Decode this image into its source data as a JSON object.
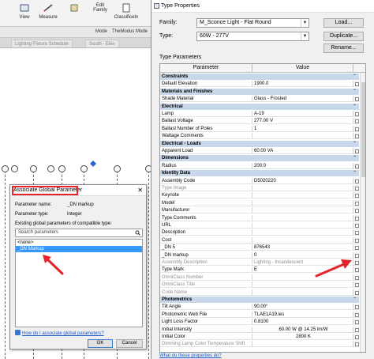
{
  "ribbon": {
    "items": [
      {
        "label": "View"
      },
      {
        "label": "Measure"
      },
      {
        "label": "Edit Family"
      },
      {
        "label": "ClassificeIn"
      },
      {
        "label": "Mode"
      },
      {
        "label": "TheModus Mode"
      }
    ]
  },
  "tabs": [
    {
      "label": "Lighting Fixture Schedule"
    },
    {
      "label": "South - Elev"
    }
  ],
  "associate_dialog": {
    "title": "Associate Global Parameter",
    "parameter_name_label": "Parameter name:",
    "parameter_name_value": "_DN markup",
    "parameter_type_label": "Parameter type:",
    "parameter_type_value": "Integer",
    "existing_label": "Existing global parameters of compatible type:",
    "search_placeholder": "Search parameters",
    "list": [
      {
        "label": "<none>",
        "selected": false
      },
      {
        "label": "_DN Markup",
        "selected": true
      }
    ],
    "help_link": "How do I associate global parameters?",
    "ok_label": "OK",
    "cancel_label": "Cancel"
  },
  "type_properties": {
    "title": "Type Properties",
    "family_label": "Family:",
    "family_value": "M_Sconce Light - Flat Round",
    "type_label": "Type:",
    "type_value": "60W - 277V",
    "load_label": "Load...",
    "duplicate_label": "Duplicate...",
    "rename_label": "Rename...",
    "type_parameters_label": "Type Parameters",
    "col_parameter": "Parameter",
    "col_value": "Value",
    "help_link": "What do these properties do?",
    "rows": [
      {
        "kind": "group",
        "label": "Constraints"
      },
      {
        "kind": "row",
        "p": "Default Elevation",
        "v": "1900.0"
      },
      {
        "kind": "group",
        "label": "Materials and Finishes"
      },
      {
        "kind": "row",
        "p": "Shade Material",
        "v": "Glass - Frosted"
      },
      {
        "kind": "group",
        "label": "Electrical"
      },
      {
        "kind": "row",
        "p": "Lamp",
        "v": "A-19"
      },
      {
        "kind": "row",
        "p": "Ballast Voltage",
        "v": "277.00 V"
      },
      {
        "kind": "row",
        "p": "Ballast Number of Poles",
        "v": "1"
      },
      {
        "kind": "row",
        "p": "Wattage Comments",
        "v": ""
      },
      {
        "kind": "group",
        "label": "Electrical - Loads"
      },
      {
        "kind": "row",
        "p": "Apparent Load",
        "v": "60.00 VA"
      },
      {
        "kind": "group",
        "label": "Dimensions"
      },
      {
        "kind": "row",
        "p": "Radius",
        "v": "200.0"
      },
      {
        "kind": "group",
        "label": "Identity Data"
      },
      {
        "kind": "row",
        "p": "Assembly Code",
        "v": "D5020220"
      },
      {
        "kind": "row",
        "p": "Type Image",
        "v": "",
        "grey": true
      },
      {
        "kind": "row",
        "p": "Keynote",
        "v": ""
      },
      {
        "kind": "row",
        "p": "Model",
        "v": ""
      },
      {
        "kind": "row",
        "p": "Manufacturer",
        "v": ""
      },
      {
        "kind": "row",
        "p": "Type Comments",
        "v": ""
      },
      {
        "kind": "row",
        "p": "URL",
        "v": ""
      },
      {
        "kind": "row",
        "p": "Description",
        "v": ""
      },
      {
        "kind": "row",
        "p": "Cost",
        "v": ""
      },
      {
        "kind": "row",
        "p": "_DN 5",
        "v": "876543"
      },
      {
        "kind": "row",
        "p": "_DN markup",
        "v": "0"
      },
      {
        "kind": "row",
        "p": "Assembly Description",
        "v": "Lighting - Incandescent",
        "grey": true
      },
      {
        "kind": "row",
        "p": "Type Mark",
        "v": "E"
      },
      {
        "kind": "row",
        "p": "OmniClass Number",
        "v": "",
        "grey": true
      },
      {
        "kind": "row",
        "p": "OmniClass Title",
        "v": "",
        "grey": true
      },
      {
        "kind": "row",
        "p": "Code Name",
        "v": "",
        "grey": true
      },
      {
        "kind": "group",
        "label": "Photometrics"
      },
      {
        "kind": "row",
        "p": "Tilt Angle",
        "v": "90.00°"
      },
      {
        "kind": "row",
        "p": "Photometric Web File",
        "v": "TLAE1A19.ies"
      },
      {
        "kind": "row",
        "p": "Light Loss Factor",
        "v": "0.8100"
      },
      {
        "kind": "row",
        "p": "Initial Intensity",
        "v": "60.00 W @ 14.25 lm/W",
        "center": true
      },
      {
        "kind": "row",
        "p": "Initial Color",
        "v": "2800 K",
        "center": true
      },
      {
        "kind": "row",
        "p": "Dimming Lamp Color Temperature Shift",
        "v": "",
        "grey": true
      }
    ]
  },
  "colors": {
    "group_header": "#c8d7ea",
    "selection": "#3399ff",
    "highlight_box": "#e3242b",
    "arrow": "#e3242b"
  }
}
